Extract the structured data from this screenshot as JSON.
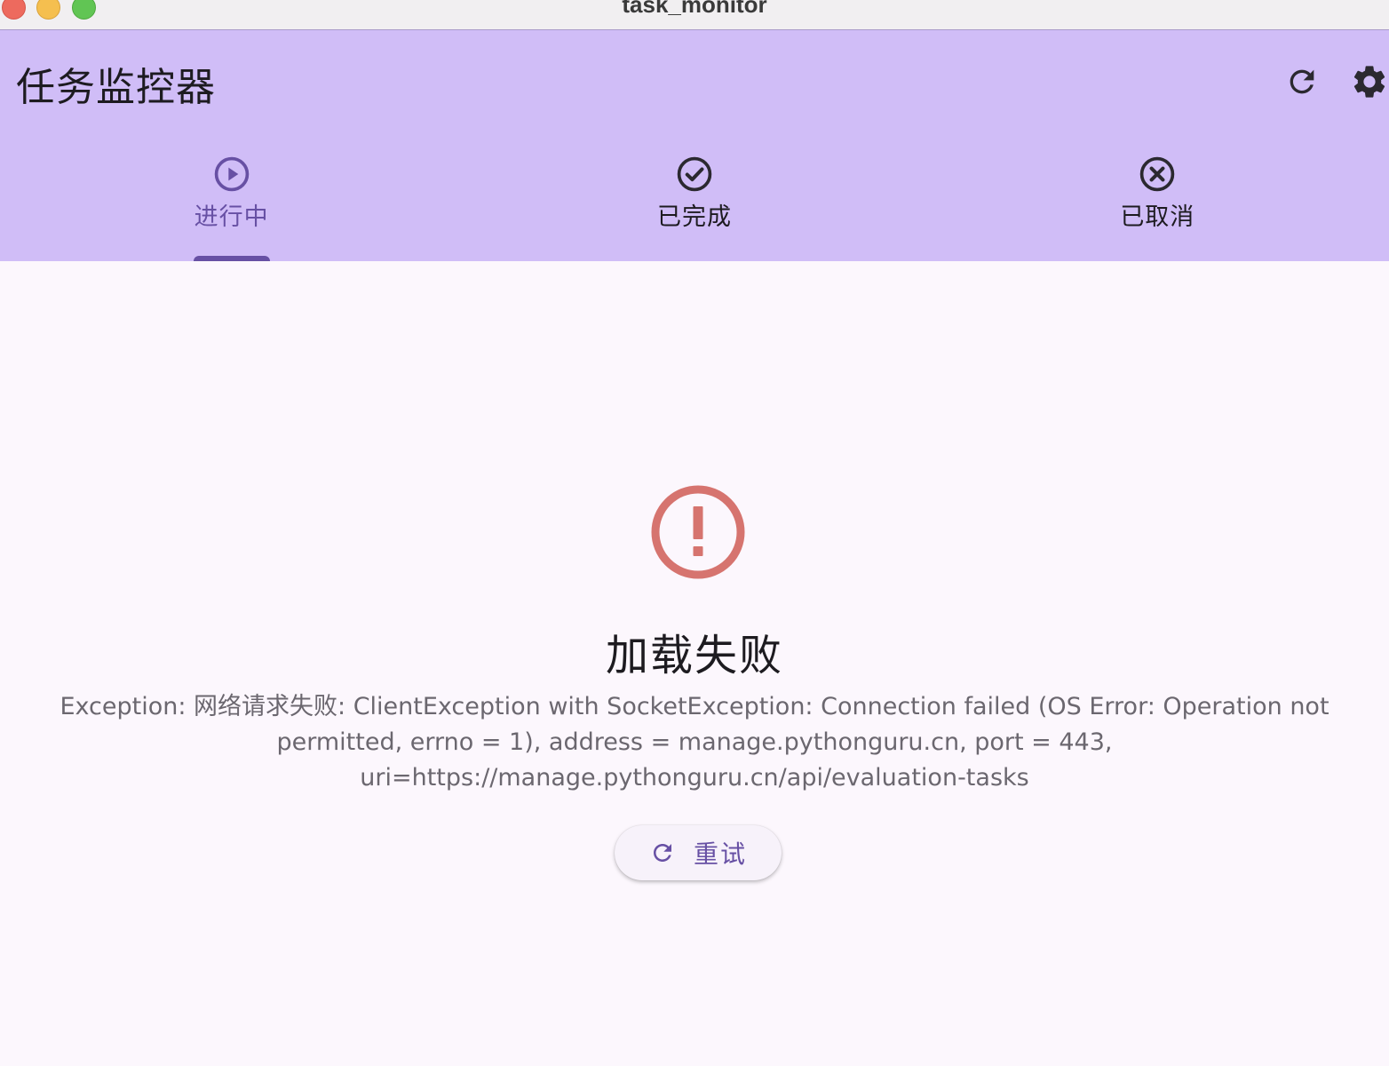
{
  "window": {
    "title": "task_monitor"
  },
  "appbar": {
    "title": "任务监控器",
    "background": "#d0bdf7",
    "actions": [
      {
        "icon": "refresh-icon"
      },
      {
        "icon": "gear-icon"
      }
    ]
  },
  "tabs": [
    {
      "label": "进行中",
      "icon": "play-circle-icon",
      "active": true
    },
    {
      "label": "已完成",
      "icon": "check-circle-icon",
      "active": false
    },
    {
      "label": "已取消",
      "icon": "cancel-circle-icon",
      "active": false
    }
  ],
  "error": {
    "icon": "error-circle-icon",
    "icon_color": "#d6746f",
    "title": "加载失败",
    "message": "Exception: 网络请求失败: ClientException with SocketException: Connection failed (OS Error: Operation not permitted, errno = 1), address = manage.pythonguru.cn, port = 443, uri=https://manage.pythonguru.cn/api/evaluation-tasks",
    "retry_label": "重试"
  },
  "colors": {
    "accent": "#6750a4",
    "surface": "#fcf7fd"
  }
}
